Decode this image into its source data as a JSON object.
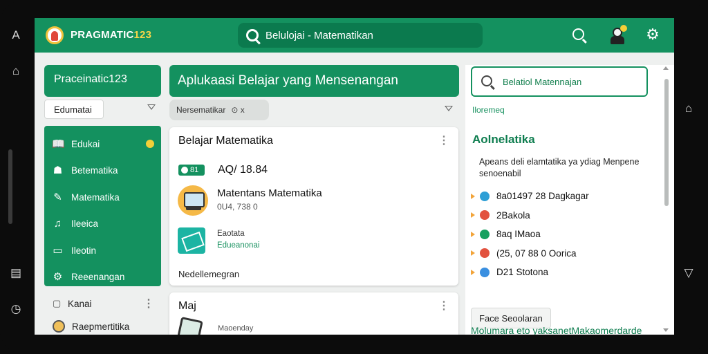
{
  "device": {
    "left_buttons": [
      "A",
      "⌂",
      "▤",
      "◷"
    ],
    "right_buttons": [
      "⌂",
      "▽"
    ]
  },
  "topbar": {
    "brand": "PRAGMATIC",
    "brand_number": "123",
    "search_text": "Belulojai - Matematikan",
    "colors": {
      "primary": "#14915f",
      "search_bg": "#0b7a4e",
      "accent": "#f3cf38"
    },
    "icons": {
      "logo": "pragmatic-logo-icon",
      "search": "search-icon",
      "profile": "profile-avatar-icon",
      "settings": "gear-icon"
    }
  },
  "sidebar": {
    "brand_card": "Praceinatic123",
    "dropdown_value": "Edumatai",
    "menu_items": [
      {
        "label": "Edukai",
        "icon": "📖"
      },
      {
        "label": "Betematika",
        "icon": "☗"
      },
      {
        "label": "Matematika",
        "icon": "✎"
      },
      {
        "label": "Ileeica",
        "icon": "♫"
      },
      {
        "label": "Ileotin",
        "icon": "▭"
      },
      {
        "label": "Reeenangan",
        "icon": "⚙"
      }
    ],
    "lower_rows": [
      {
        "label": "Kanai",
        "icon": "▢"
      },
      {
        "label": "Raepmertitika"
      }
    ]
  },
  "main": {
    "title": "Aplukaasi Belajar yang Mensenangan",
    "filter_chip": "Nersematikar",
    "filter_close": "⊙ x",
    "card1": {
      "title": "Belajar Matematika",
      "stat_badge": "81",
      "stat_text": "AQ/ 18.84",
      "course_title": "Matentans Matematika",
      "course_meta": "0U4, 738 0",
      "edu_title": "Eaotata",
      "edu_sub": "Edueanonai",
      "footer": "Nedellemegran"
    },
    "card2": {
      "title": "Maj",
      "meta": "Maoenday"
    }
  },
  "right_panel": {
    "search_text": "Belatiol Matennajan",
    "small_label": "Iloremeq",
    "heading": "Aolnelatika",
    "description_lines": [
      "Apeans deli elamtatika ya ydiag Menpene",
      "senoenabil"
    ],
    "list_items": [
      {
        "label": "8a01497 28 Dagkagar",
        "color": "#2e9fd6"
      },
      {
        "label": "2Bakola",
        "color": "#e2523f"
      },
      {
        "label": "8aq IMaoa",
        "color": "#16a05f"
      },
      {
        "label": "(25, 07 88 0 Oorica",
        "color": "#e2523f"
      },
      {
        "label": "D21 Stotona",
        "color": "#3a8fe0"
      }
    ],
    "button": "Face Seoolaran",
    "footer": "Molumara eto yaksanetMakaomerdarde"
  }
}
